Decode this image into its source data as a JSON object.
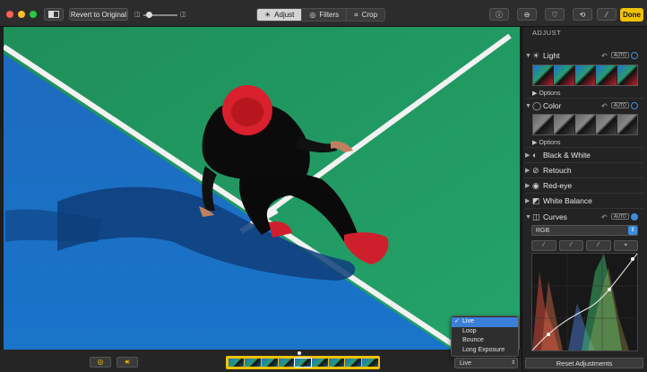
{
  "toolbar": {
    "revert_label": "Revert to Original",
    "tabs": [
      {
        "label": "Adjust",
        "active": true
      },
      {
        "label": "Filters",
        "active": false
      },
      {
        "label": "Crop",
        "active": false
      }
    ],
    "done_label": "Done",
    "icons": [
      "info-icon",
      "more-icon",
      "heart-icon",
      "rotate-icon",
      "magic-wand-icon"
    ]
  },
  "sidebar": {
    "header": "ADJUST",
    "light": {
      "label": "Light",
      "options": "Options",
      "auto": "AUTO"
    },
    "color": {
      "label": "Color",
      "options": "Options",
      "auto": "AUTO"
    },
    "bw": {
      "label": "Black & White"
    },
    "retouch": {
      "label": "Retouch"
    },
    "redeye": {
      "label": "Red-eye"
    },
    "wb": {
      "label": "White Balance"
    },
    "curves": {
      "label": "Curves",
      "auto": "AUTO",
      "channel": "RGB"
    },
    "reset_label": "Reset Adjustments"
  },
  "live_menu": {
    "items": [
      "Live",
      "Loop",
      "Bounce",
      "Long Exposure"
    ],
    "selected": "Live"
  },
  "live_select": {
    "value": "Live"
  },
  "colors": {
    "accent": "#f2c200",
    "selection": "#3b7fd9",
    "court_blue": "#1f6fc4",
    "court_green": "#1f9a5e"
  }
}
